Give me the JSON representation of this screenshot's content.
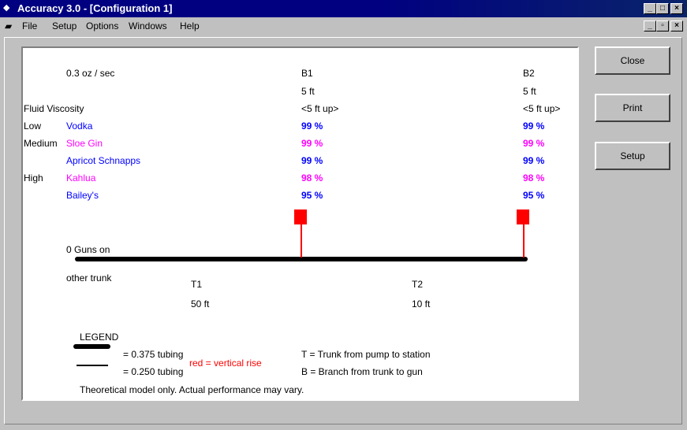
{
  "window": {
    "title": "Accuracy 3.0 - [Configuration 1]"
  },
  "menu": {
    "file": "File",
    "setup": "Setup",
    "options": "Options",
    "windows": "Windows",
    "help": "Help"
  },
  "buttons": {
    "close": "Close",
    "print": "Print",
    "setup": "Setup"
  },
  "report": {
    "flow_rate": "0.3 oz / sec",
    "fluid_viscosity_label": "Fluid Viscosity",
    "branches": [
      {
        "name": "B1",
        "length": "5 ft",
        "rise": "<5 ft up>"
      },
      {
        "name": "B2",
        "length": "5 ft",
        "rise": "<5 ft up>"
      }
    ],
    "rows": [
      {
        "viscosity": "Low",
        "fluid": "Vodka",
        "b1": "99 %",
        "b2": "99 %",
        "color": "#0000ff"
      },
      {
        "viscosity": "Medium",
        "fluid": "Sloe Gin",
        "b1": "99 %",
        "b2": "99 %",
        "color": "#ff00ff"
      },
      {
        "viscosity": "",
        "fluid": "Apricot Schnapps",
        "b1": "99 %",
        "b2": "99 %",
        "color": "#0000ff"
      },
      {
        "viscosity": "High",
        "fluid": "Kahlua",
        "b1": "98 %",
        "b2": "98 %",
        "color": "#ff00ff"
      },
      {
        "viscosity": "",
        "fluid": "Bailey's",
        "b1": "95 %",
        "b2": "95 %",
        "color": "#0000ff"
      }
    ],
    "guns_on": "0 Guns on",
    "other_trunk": "other trunk",
    "trunks": [
      {
        "name": "T1",
        "length": "50 ft"
      },
      {
        "name": "T2",
        "length": "10 ft"
      }
    ],
    "legend": {
      "title": "LEGEND",
      "thick": "= 0.375 tubing",
      "thin": "= 0.250 tubing",
      "red": "red = vertical rise",
      "t_def": "T = Trunk from pump to station",
      "b_def": "B = Branch from trunk to gun"
    },
    "disclaimer": "Theoretical model only. Actual performance may vary."
  },
  "colors": {
    "rise": "#ff0000",
    "blue": "#0000ff",
    "magenta": "#ff00ff"
  }
}
